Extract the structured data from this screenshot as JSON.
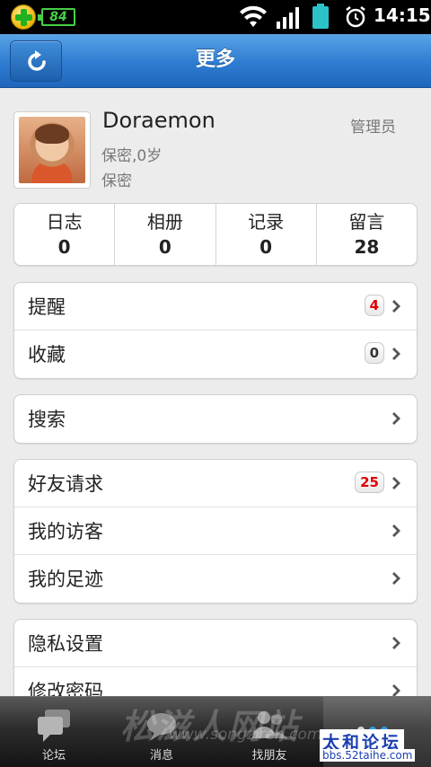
{
  "status_bar": {
    "time": "14:15",
    "small_battery": "84"
  },
  "header": {
    "title": "更多"
  },
  "profile": {
    "name": "Doraemon",
    "gender_age": "保密,0岁",
    "location": "保密",
    "role": "管理员"
  },
  "stats": [
    {
      "label": "日志",
      "value": "0"
    },
    {
      "label": "相册",
      "value": "0"
    },
    {
      "label": "记录",
      "value": "0"
    },
    {
      "label": "留言",
      "value": "28"
    }
  ],
  "groups": {
    "notify": [
      {
        "label": "提醒",
        "badge": "4"
      },
      {
        "label": "收藏",
        "badge": "0"
      }
    ],
    "search": [
      {
        "label": "搜索"
      }
    ],
    "friends": [
      {
        "label": "好友请求",
        "badge": "25"
      },
      {
        "label": "我的访客"
      },
      {
        "label": "我的足迹"
      }
    ],
    "settings": [
      {
        "label": "隐私设置"
      },
      {
        "label": "修改密码"
      }
    ]
  },
  "tabbar": {
    "tabs": [
      {
        "label": "论坛"
      },
      {
        "label": "消息"
      },
      {
        "label": "找朋友"
      }
    ]
  },
  "watermark": {
    "text1": "松滋人网站",
    "text2": "www.songziren.com",
    "text3": "太和论坛",
    "text4": "bbs.52taihe.com"
  },
  "colors": {
    "header_blue": "#2e7cd1",
    "badge_red": "#e00000",
    "active_dot": "#2f9be0"
  }
}
